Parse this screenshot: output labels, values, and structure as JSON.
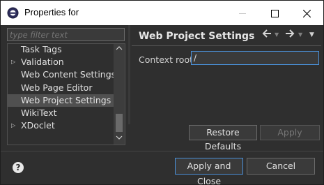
{
  "window": {
    "title": "Properties for",
    "minimize_icon": "minimize-icon",
    "maximize_icon": "maximize-icon",
    "close_icon": "close-icon"
  },
  "filter": {
    "placeholder": "type filter text"
  },
  "tree": {
    "items": [
      {
        "label": "Task Tags",
        "expandable": false,
        "selected": false
      },
      {
        "label": "Validation",
        "expandable": true,
        "selected": false
      },
      {
        "label": "Web Content Settings",
        "expandable": false,
        "selected": false
      },
      {
        "label": "Web Page Editor",
        "expandable": false,
        "selected": false
      },
      {
        "label": "Web Project Settings",
        "expandable": false,
        "selected": true
      },
      {
        "label": "WikiText",
        "expandable": false,
        "selected": false
      },
      {
        "label": "XDoclet",
        "expandable": true,
        "selected": false
      }
    ]
  },
  "page": {
    "title": "Web Project Settings",
    "context_root_label": "Context root:",
    "context_root_value": "/"
  },
  "buttons": {
    "restore_defaults": "Restore Defaults",
    "apply": "Apply",
    "apply_and_close": "Apply and Close",
    "cancel": "Cancel",
    "help": "?"
  },
  "colors": {
    "background": "#2f2f2f",
    "focus_border": "#4a90d9",
    "selection": "#505050"
  }
}
